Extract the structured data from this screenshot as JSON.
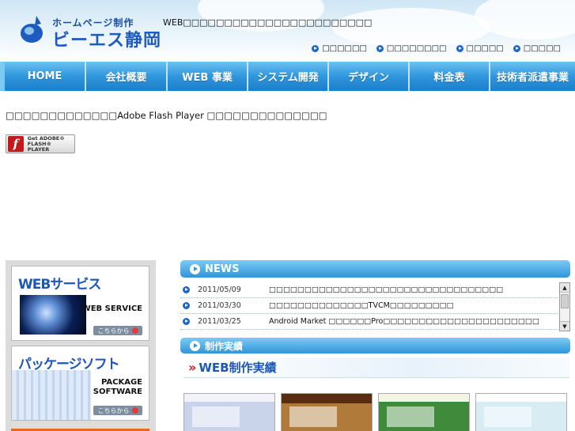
{
  "header": {
    "logo_small": "ホームページ制作",
    "logo_big": "ビーエス静岡",
    "tagline": "WEB□□□□□□□□□□□□□□□□□□□□□□□",
    "util_links": [
      "□□□□□□",
      "□□□□□□□□",
      "□□□□□",
      "□□□□□"
    ]
  },
  "nav": {
    "items": [
      "HOME",
      "会社概要",
      "WEB 事業",
      "システム開発",
      "デザイン",
      "料金表",
      "技術者派遣事業"
    ]
  },
  "flash": {
    "message": "□□□□□□□□□□□□□Adobe Flash Player □□□□□□□□□□□□□□",
    "badge_line1": "Get ADOBE®",
    "badge_line2": "FLASH® PLAYER",
    "badge_icon": "f"
  },
  "sidebar": {
    "banners": [
      {
        "title": "WEBサービス",
        "subtitle": "WEB SERVICE",
        "button": "こちらから"
      },
      {
        "title": "パッケージソフト",
        "subtitle_line1": "PACKAGE",
        "subtitle_line2": "SOFTWARE",
        "button": "こちらから"
      }
    ]
  },
  "news": {
    "heading": "NEWS",
    "items": [
      {
        "date": "2011/05/09",
        "text": "□□□□□□□□□□□□□□□□□□□□□□□□□□□□□□□□□"
      },
      {
        "date": "2011/03/30",
        "text": "□□□□□□□□□□□□□□TVCM□□□□□□□□□"
      },
      {
        "date": "2011/03/25",
        "text": "Android Market □□□□□□Pro□□□□□□□□□□□□□□□□□□□□□□"
      }
    ]
  },
  "works": {
    "heading": "制作実績",
    "subheading": "WEB制作実績"
  }
}
